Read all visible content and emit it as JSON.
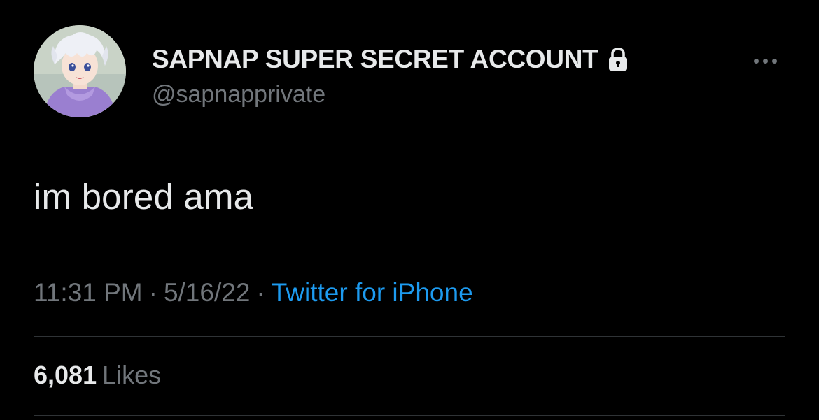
{
  "tweet": {
    "author": {
      "display_name": "SAPNAP SUPER SECRET ACCOUNT",
      "handle": "@sapnapprivate",
      "protected_icon": "lock-icon",
      "avatar": "profile-avatar"
    },
    "text": "im bored ama",
    "time": "11:31 PM",
    "date": "5/16/22",
    "separator": "·",
    "source": "Twitter for iPhone",
    "likes_count": "6,081",
    "likes_label": "Likes",
    "more_icon": "more-options-icon"
  },
  "colors": {
    "background": "#000000",
    "primary_text": "#e7e9ea",
    "secondary_text": "#71767b",
    "accent": "#1d9bf0",
    "divider": "#2f3336"
  }
}
